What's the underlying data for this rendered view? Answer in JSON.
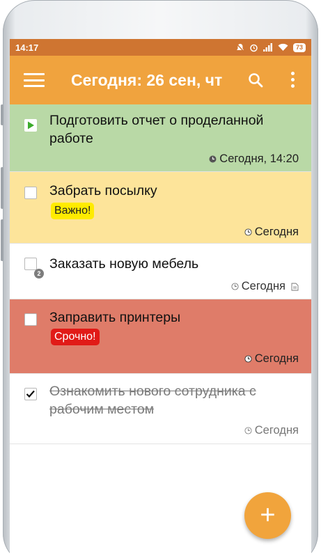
{
  "status_bar": {
    "time": "14:17",
    "battery": "73"
  },
  "app_bar": {
    "title": "Сегодня: 26 сен, чт"
  },
  "tasks": [
    {
      "title": "Подготовить отчет о проделанной работе",
      "due": "Сегодня, 14:20",
      "background": "#b9d9a6"
    },
    {
      "title": "Забрать посылку",
      "tag": "Важно!",
      "tag_color": "#ffeb00",
      "due": "Сегодня",
      "background": "#fde49a"
    },
    {
      "title": "Заказать новую мебель",
      "subtask_count": "2",
      "due": "Сегодня",
      "background": "#ffffff"
    },
    {
      "title": "Заправить принтеры",
      "tag": "Срочно!",
      "tag_color": "#e11b17",
      "due": "Сегодня",
      "background": "#df7c69"
    },
    {
      "title": "Ознакомить нового сотрудника с рабочим местом",
      "due": "Сегодня",
      "completed": true,
      "background": "#ffffff"
    }
  ],
  "fab": {
    "label": "+"
  }
}
